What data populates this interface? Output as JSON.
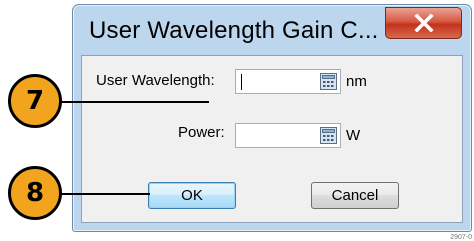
{
  "window": {
    "title": "User Wavelength Gain C...",
    "close_glyph": "X"
  },
  "form": {
    "wavelength": {
      "label": "User Wavelength:",
      "value": "",
      "unit": "nm",
      "icon": "calculator-icon"
    },
    "power": {
      "label": "Power:",
      "value": "",
      "unit": "W",
      "icon": "calculator-icon"
    }
  },
  "buttons": {
    "ok": "OK",
    "cancel": "Cancel"
  },
  "callouts": {
    "seven": "7",
    "eight": "8"
  },
  "figure_id": "2907-0",
  "colors": {
    "callout_fill": "#f3a41e",
    "title_bar": "#bcd6ee",
    "close_red": "#c2331c"
  }
}
